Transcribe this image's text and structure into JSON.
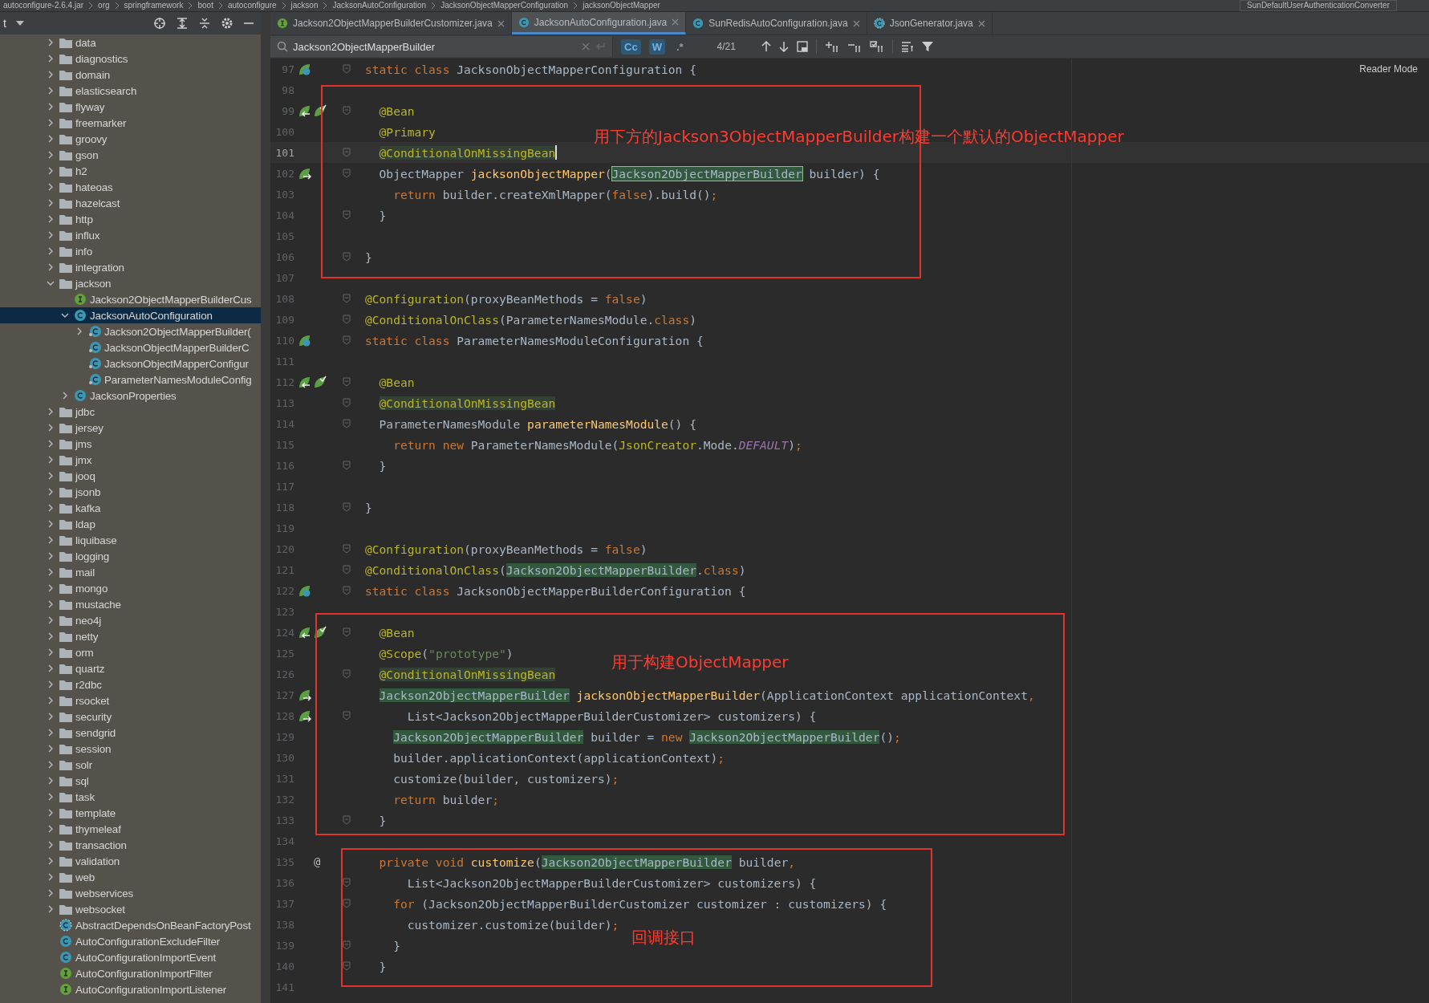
{
  "breadcrumb": [
    "autoconfigure-2.6.4.jar",
    "org",
    "springframework",
    "boot",
    "autoconfigure",
    "jackson",
    "JacksonAutoConfiguration",
    "JacksonObjectMapperConfiguration",
    "jacksonObjectMapper"
  ],
  "run_config": "SunDefaultUserAuthenticationConverter",
  "sidebar": {
    "title": "t",
    "tree": [
      {
        "label": "data",
        "kind": "folder",
        "expanded": false
      },
      {
        "label": "diagnostics",
        "kind": "folder",
        "expanded": false
      },
      {
        "label": "domain",
        "kind": "folder",
        "expanded": false
      },
      {
        "label": "elasticsearch",
        "kind": "folder",
        "expanded": false
      },
      {
        "label": "flyway",
        "kind": "folder",
        "expanded": false
      },
      {
        "label": "freemarker",
        "kind": "folder",
        "expanded": false
      },
      {
        "label": "groovy",
        "kind": "folder",
        "expanded": false
      },
      {
        "label": "gson",
        "kind": "folder",
        "expanded": false
      },
      {
        "label": "h2",
        "kind": "folder",
        "expanded": false
      },
      {
        "label": "hateoas",
        "kind": "folder",
        "expanded": false
      },
      {
        "label": "hazelcast",
        "kind": "folder",
        "expanded": false
      },
      {
        "label": "http",
        "kind": "folder",
        "expanded": false
      },
      {
        "label": "influx",
        "kind": "folder",
        "expanded": false
      },
      {
        "label": "info",
        "kind": "folder",
        "expanded": false
      },
      {
        "label": "integration",
        "kind": "folder",
        "expanded": false
      },
      {
        "label": "jackson",
        "kind": "folder",
        "expanded": true,
        "children": [
          {
            "label": "Jackson2ObjectMapperBuilderCus",
            "kind": "interface",
            "selected": false
          },
          {
            "label": "JacksonAutoConfiguration",
            "kind": "class",
            "expanded": true,
            "selected": true,
            "children": [
              {
                "label": "Jackson2ObjectMapperBuilder(",
                "kind": "inner",
                "expanded": false,
                "selected": false
              },
              {
                "label": "JacksonObjectMapperBuilderC",
                "kind": "inner",
                "selected": false
              },
              {
                "label": "JacksonObjectMapperConfigur",
                "kind": "inner",
                "selected": false
              },
              {
                "label": "ParameterNamesModuleConfig",
                "kind": "inner",
                "selected": false
              }
            ]
          },
          {
            "label": "JacksonProperties",
            "kind": "class",
            "expanded": false,
            "selected": false
          }
        ]
      },
      {
        "label": "jdbc",
        "kind": "folder",
        "expanded": false
      },
      {
        "label": "jersey",
        "kind": "folder",
        "expanded": false
      },
      {
        "label": "jms",
        "kind": "folder",
        "expanded": false
      },
      {
        "label": "jmx",
        "kind": "folder",
        "expanded": false
      },
      {
        "label": "jooq",
        "kind": "folder",
        "expanded": false
      },
      {
        "label": "jsonb",
        "kind": "folder",
        "expanded": false
      },
      {
        "label": "kafka",
        "kind": "folder",
        "expanded": false
      },
      {
        "label": "ldap",
        "kind": "folder",
        "expanded": false
      },
      {
        "label": "liquibase",
        "kind": "folder",
        "expanded": false
      },
      {
        "label": "logging",
        "kind": "folder",
        "expanded": false
      },
      {
        "label": "mail",
        "kind": "folder",
        "expanded": false
      },
      {
        "label": "mongo",
        "kind": "folder",
        "expanded": false
      },
      {
        "label": "mustache",
        "kind": "folder",
        "expanded": false
      },
      {
        "label": "neo4j",
        "kind": "folder",
        "expanded": false
      },
      {
        "label": "netty",
        "kind": "folder",
        "expanded": false
      },
      {
        "label": "orm",
        "kind": "folder",
        "expanded": false
      },
      {
        "label": "quartz",
        "kind": "folder",
        "expanded": false
      },
      {
        "label": "r2dbc",
        "kind": "folder",
        "expanded": false
      },
      {
        "label": "rsocket",
        "kind": "folder",
        "expanded": false
      },
      {
        "label": "security",
        "kind": "folder",
        "expanded": false
      },
      {
        "label": "sendgrid",
        "kind": "folder",
        "expanded": false
      },
      {
        "label": "session",
        "kind": "folder",
        "expanded": false
      },
      {
        "label": "solr",
        "kind": "folder",
        "expanded": false
      },
      {
        "label": "sql",
        "kind": "folder",
        "expanded": false
      },
      {
        "label": "task",
        "kind": "folder",
        "expanded": false
      },
      {
        "label": "template",
        "kind": "folder",
        "expanded": false
      },
      {
        "label": "thymeleaf",
        "kind": "folder",
        "expanded": false
      },
      {
        "label": "transaction",
        "kind": "folder",
        "expanded": false
      },
      {
        "label": "validation",
        "kind": "folder",
        "expanded": false
      },
      {
        "label": "web",
        "kind": "folder",
        "expanded": false
      },
      {
        "label": "webservices",
        "kind": "folder",
        "expanded": false
      },
      {
        "label": "websocket",
        "kind": "folder",
        "expanded": false
      },
      {
        "label": "AbstractDependsOnBeanFactoryPost",
        "kind": "abstract",
        "selected": false
      },
      {
        "label": "AutoConfigurationExcludeFilter",
        "kind": "class",
        "selected": false
      },
      {
        "label": "AutoConfigurationImportEvent",
        "kind": "class",
        "selected": false
      },
      {
        "label": "AutoConfigurationImportFilter",
        "kind": "interface",
        "selected": false
      },
      {
        "label": "AutoConfigurationImportListener",
        "kind": "interface",
        "selected": false
      }
    ]
  },
  "tabs": [
    {
      "label": "Jackson2ObjectMapperBuilderCustomizer.java",
      "kind": "interface",
      "selected": false
    },
    {
      "label": "JacksonAutoConfiguration.java",
      "kind": "class",
      "selected": true
    },
    {
      "label": "SunRedisAutoConfiguration.java",
      "kind": "class",
      "selected": false
    },
    {
      "label": "JsonGenerator.java",
      "kind": "abstract",
      "selected": false
    }
  ],
  "find": {
    "value": "Jackson2ObjectMapperBuilder",
    "match_case": true,
    "words": true,
    "regex": false,
    "toggle_labels": [
      "Cc",
      "W",
      ".*"
    ],
    "count": "4/21"
  },
  "reader_mode": "Reader Mode",
  "code": [
    {
      "n": "97",
      "fold": true,
      "gutter": [
        {
          "kind": "bean"
        }
      ],
      "t": [
        {
          "kind": "kw",
          "text": "static class "
        },
        {
          "kind": "p",
          "text": "JacksonObjectMapperConfiguration {"
        }
      ]
    },
    {
      "n": "98",
      "fold": false
    },
    {
      "n": "99",
      "fold": true,
      "gutter": [
        {
          "kind": "override"
        },
        {
          "kind": "check"
        }
      ],
      "t": [
        {
          "kind": "ann",
          "text": "  @Bean"
        }
      ]
    },
    {
      "n": "100",
      "fold": false,
      "t": [
        {
          "kind": "ann",
          "text": "  @Primary"
        }
      ]
    },
    {
      "n": "101",
      "fold": true,
      "current": true,
      "t": [
        {
          "kind": "annhl",
          "text": "  @ConditionalOnMissingBean"
        }
      ]
    },
    {
      "n": "102",
      "fold": true,
      "gutter": [
        {
          "kind": "nav"
        }
      ],
      "t": [
        {
          "kind": "p",
          "text": "  ObjectMapper "
        },
        {
          "kind": "fn",
          "text": "jacksonObjectMapper"
        },
        {
          "kind": "p",
          "text": "("
        },
        {
          "kind": "hlbox",
          "text": "Jackson2ObjectMapperBuilder"
        },
        {
          "kind": "p",
          "text": " builder) {"
        }
      ]
    },
    {
      "n": "103",
      "fold": false,
      "t": [
        {
          "kind": "kw",
          "text": "    return "
        },
        {
          "kind": "p",
          "text": "builder.createXmlMapper("
        },
        {
          "kind": "kw",
          "text": "false"
        },
        {
          "kind": "p",
          "text": ").build()"
        },
        {
          "kind": "kw",
          "text": ";"
        }
      ]
    },
    {
      "n": "104",
      "fold": true,
      "t": [
        {
          "kind": "p",
          "text": "  }"
        }
      ]
    },
    {
      "n": "105",
      "fold": false
    },
    {
      "n": "106",
      "fold": true,
      "t": [
        {
          "kind": "p",
          "text": "}"
        }
      ]
    },
    {
      "n": "107",
      "fold": false
    },
    {
      "n": "108",
      "fold": true,
      "t": [
        {
          "kind": "ann",
          "text": "@Configuration"
        },
        {
          "kind": "p",
          "text": "(proxyBeanMethods = "
        },
        {
          "kind": "kw",
          "text": "false"
        },
        {
          "kind": "p",
          "text": ")"
        }
      ]
    },
    {
      "n": "109",
      "fold": true,
      "t": [
        {
          "kind": "ann",
          "text": "@ConditionalOnClass"
        },
        {
          "kind": "p",
          "text": "(ParameterNamesModule."
        },
        {
          "kind": "kw",
          "text": "class"
        },
        {
          "kind": "p",
          "text": ")"
        }
      ]
    },
    {
      "n": "110",
      "fold": true,
      "gutter": [
        {
          "kind": "bean"
        }
      ],
      "t": [
        {
          "kind": "kw",
          "text": "static class "
        },
        {
          "kind": "p",
          "text": "ParameterNamesModuleConfiguration {"
        }
      ]
    },
    {
      "n": "111",
      "fold": false
    },
    {
      "n": "112",
      "fold": true,
      "gutter": [
        {
          "kind": "override"
        },
        {
          "kind": "check"
        }
      ],
      "t": [
        {
          "kind": "ann",
          "text": "  @Bean"
        }
      ]
    },
    {
      "n": "113",
      "fold": true,
      "t": [
        {
          "kind": "annhl",
          "text": "  @ConditionalOnMissingBean"
        }
      ]
    },
    {
      "n": "114",
      "fold": true,
      "t": [
        {
          "kind": "p",
          "text": "  ParameterNamesModule "
        },
        {
          "kind": "fn",
          "text": "parameterNamesModule"
        },
        {
          "kind": "p",
          "text": "() {"
        }
      ]
    },
    {
      "n": "115",
      "fold": false,
      "t": [
        {
          "kind": "kw",
          "text": "    return new "
        },
        {
          "kind": "p",
          "text": "ParameterNamesModule("
        },
        {
          "kind": "ann",
          "text": "JsonCreator"
        },
        {
          "kind": "p",
          "text": ".Mode."
        },
        {
          "kind": "const",
          "text": "DEFAULT"
        },
        {
          "kind": "p",
          "text": ")"
        },
        {
          "kind": "kw",
          "text": ";"
        }
      ]
    },
    {
      "n": "116",
      "fold": true,
      "t": [
        {
          "kind": "p",
          "text": "  }"
        }
      ]
    },
    {
      "n": "117",
      "fold": false
    },
    {
      "n": "118",
      "fold": true,
      "t": [
        {
          "kind": "p",
          "text": "}"
        }
      ]
    },
    {
      "n": "119",
      "fold": false
    },
    {
      "n": "120",
      "fold": true,
      "t": [
        {
          "kind": "ann",
          "text": "@Configuration"
        },
        {
          "kind": "p",
          "text": "(proxyBeanMethods = "
        },
        {
          "kind": "kw",
          "text": "false"
        },
        {
          "kind": "p",
          "text": ")"
        }
      ]
    },
    {
      "n": "121",
      "fold": true,
      "t": [
        {
          "kind": "ann",
          "text": "@ConditionalOnClass"
        },
        {
          "kind": "p",
          "text": "("
        },
        {
          "kind": "hl",
          "text": "Jackson2ObjectMapperBuilder"
        },
        {
          "kind": "p",
          "text": "."
        },
        {
          "kind": "kw",
          "text": "class"
        },
        {
          "kind": "p",
          "text": ")"
        }
      ]
    },
    {
      "n": "122",
      "fold": true,
      "gutter": [
        {
          "kind": "bean"
        }
      ],
      "t": [
        {
          "kind": "kw",
          "text": "static class "
        },
        {
          "kind": "p",
          "text": "JacksonObjectMapperBuilderConfiguration {"
        }
      ]
    },
    {
      "n": "123",
      "fold": false
    },
    {
      "n": "124",
      "fold": true,
      "gutter": [
        {
          "kind": "override"
        },
        {
          "kind": "check"
        }
      ],
      "t": [
        {
          "kind": "ann",
          "text": "  @Bean"
        }
      ]
    },
    {
      "n": "125",
      "fold": false,
      "t": [
        {
          "kind": "ann",
          "text": "  @Scope"
        },
        {
          "kind": "p",
          "text": "("
        },
        {
          "kind": "str",
          "text": "\"prototype\""
        },
        {
          "kind": "p",
          "text": ")"
        }
      ]
    },
    {
      "n": "126",
      "fold": true,
      "t": [
        {
          "kind": "annhl",
          "text": "  @ConditionalOnMissingBean"
        }
      ]
    },
    {
      "n": "127",
      "fold": false,
      "gutter": [
        {
          "kind": "nav"
        }
      ],
      "t": [
        {
          "kind": "hl",
          "text": "  Jackson2ObjectMapperBuilder"
        },
        {
          "kind": "fn",
          "text": " jacksonObjectMapperBuilder"
        },
        {
          "kind": "p",
          "text": "(ApplicationContext applicationContext"
        },
        {
          "kind": "kw",
          "text": ","
        }
      ]
    },
    {
      "n": "128",
      "fold": true,
      "gutter": [
        {
          "kind": "nav"
        }
      ],
      "t": [
        {
          "kind": "p",
          "text": "      List<Jackson2ObjectMapperBuilderCustomizer> customizers) {"
        }
      ]
    },
    {
      "n": "129",
      "fold": false,
      "t": [
        {
          "kind": "hl",
          "text": "    Jackson2ObjectMapperBuilder"
        },
        {
          "kind": "p",
          "text": " builder = "
        },
        {
          "kind": "kw",
          "text": "new "
        },
        {
          "kind": "hl",
          "text": "Jackson2ObjectMapperBuilder"
        },
        {
          "kind": "p",
          "text": "()"
        },
        {
          "kind": "kw",
          "text": ";"
        }
      ]
    },
    {
      "n": "130",
      "fold": false,
      "t": [
        {
          "kind": "p",
          "text": "    builder.applicationContext(applicationContext)"
        },
        {
          "kind": "kw",
          "text": ";"
        }
      ]
    },
    {
      "n": "131",
      "fold": false,
      "t": [
        {
          "kind": "p",
          "text": "    customize(builder, customizers)"
        },
        {
          "kind": "kw",
          "text": ";"
        }
      ]
    },
    {
      "n": "132",
      "fold": false,
      "t": [
        {
          "kind": "kw",
          "text": "    return "
        },
        {
          "kind": "p",
          "text": "builder"
        },
        {
          "kind": "kw",
          "text": ";"
        }
      ]
    },
    {
      "n": "133",
      "fold": true,
      "t": [
        {
          "kind": "p",
          "text": "  }"
        }
      ]
    },
    {
      "n": "134",
      "fold": false
    },
    {
      "n": "135",
      "fold": false,
      "gutter_text": "@",
      "t": [
        {
          "kind": "kw",
          "text": "  private void "
        },
        {
          "kind": "fn",
          "text": "customize"
        },
        {
          "kind": "p",
          "text": "("
        },
        {
          "kind": "hl",
          "text": "Jackson2ObjectMapperBuilder"
        },
        {
          "kind": "p",
          "text": " builder"
        },
        {
          "kind": "kw",
          "text": ","
        }
      ]
    },
    {
      "n": "136",
      "fold": true,
      "t": [
        {
          "kind": "p",
          "text": "      List<Jackson2ObjectMapperBuilderCustomizer> customizers) {"
        }
      ]
    },
    {
      "n": "137",
      "fold": true,
      "t": [
        {
          "kind": "kw",
          "text": "    for "
        },
        {
          "kind": "p",
          "text": "(Jackson2ObjectMapperBuilderCustomizer customizer : customizers) {"
        }
      ]
    },
    {
      "n": "138",
      "fold": false,
      "t": [
        {
          "kind": "p",
          "text": "      customizer.customize(builder)"
        },
        {
          "kind": "kw",
          "text": ";"
        }
      ]
    },
    {
      "n": "139",
      "fold": true,
      "t": [
        {
          "kind": "p",
          "text": "    }"
        }
      ]
    },
    {
      "n": "140",
      "fold": true,
      "t": [
        {
          "kind": "p",
          "text": "  }"
        }
      ]
    },
    {
      "n": "141",
      "fold": false
    }
  ],
  "annotations": [
    {
      "text": "用下方的Jackson3ObjectMapperBuilder构建一个默认的ObjectMapper"
    },
    {
      "text": "用于构建ObjectMapper"
    },
    {
      "text": "回调接口"
    }
  ]
}
